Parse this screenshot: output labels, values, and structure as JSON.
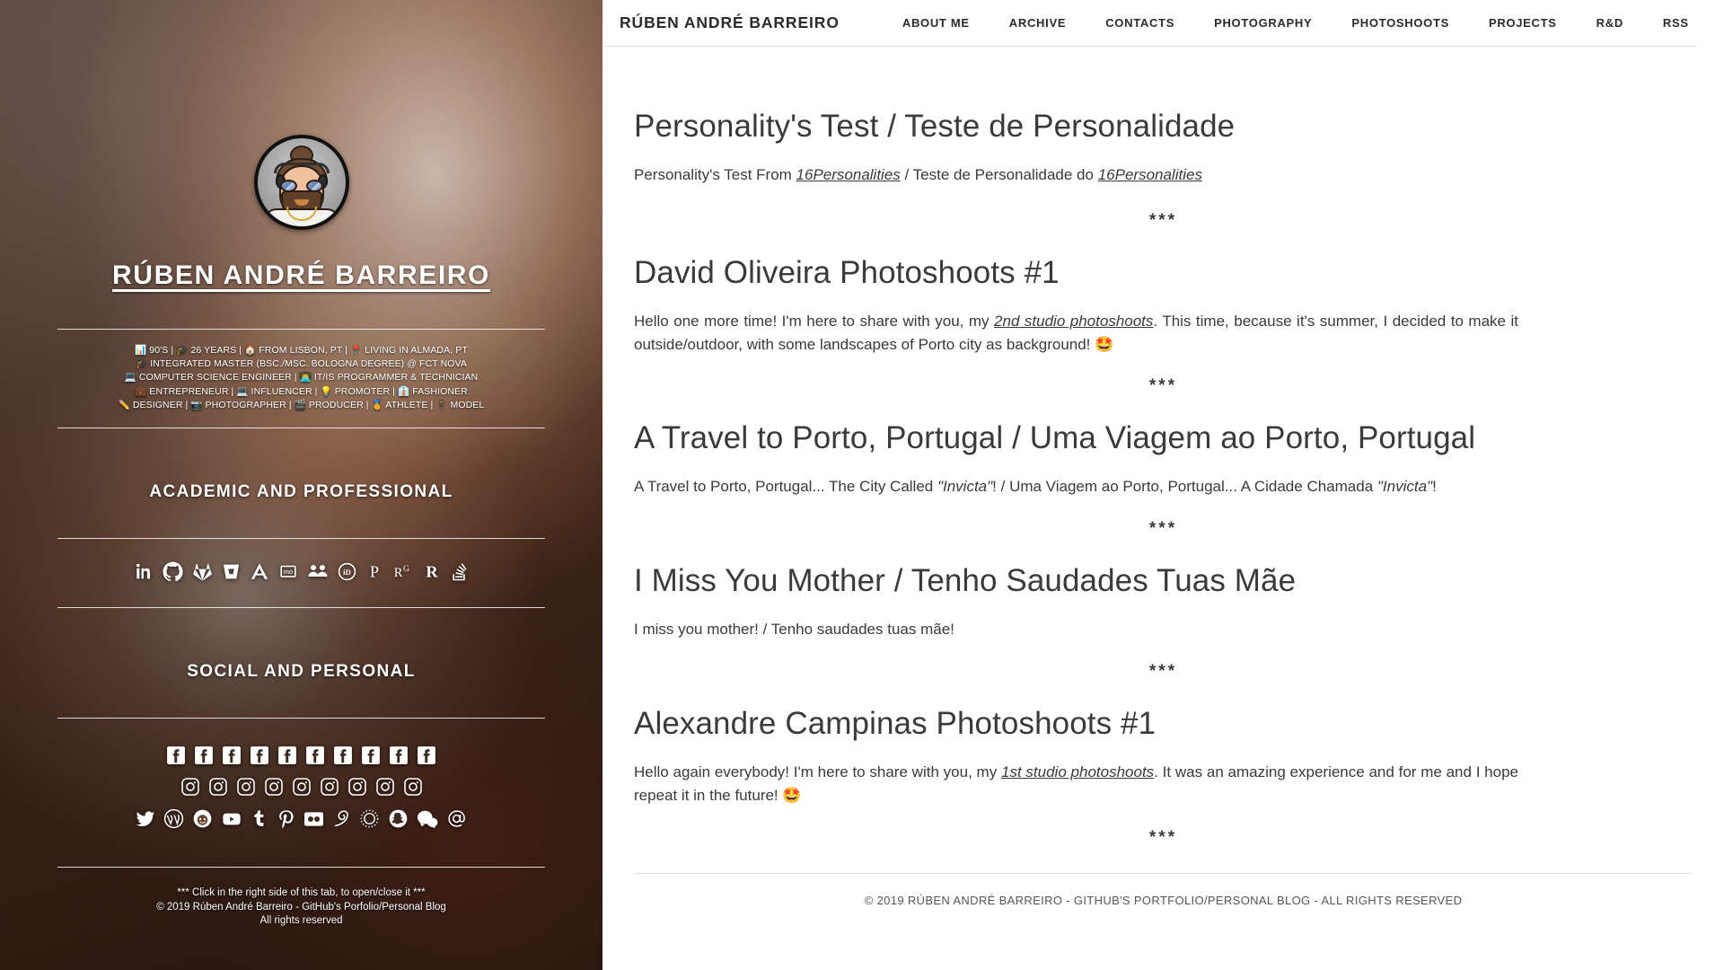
{
  "sidebar": {
    "avatar_alt": "avatar-cartoon-portrait",
    "name": "RÚBEN ANDRÉ BARREIRO",
    "bio_lines": [
      "📊 90'S | 🎓 26 YEARS | 🏠 FROM LISBON, PT | 📍 LIVING IN ALMADA, PT",
      "🎓 INTEGRATED MASTER (BSC./MSC. BOLOGNA DEGREE) @ FCT NOVA",
      "💻 COMPUTER SCIENCE ENGINEER | 👨‍💻 IT/IS PROGRAMMER & TECHNICIAN",
      "💼 ENTREPRENEUR | 💻 INFLUENCER | 💡 PROMOTER | 👔 FASHIONER",
      "✏️ DESIGNER | 📷 PHOTOGRAPHER | 🎬 PRODUCER | 🏅 ATHLETE | 🕴 MODEL"
    ],
    "section_academic": "ACADEMIC AND PROFESSIONAL",
    "section_social": "SOCIAL AND PERSONAL",
    "academic_icons": [
      "linkedin-icon",
      "github-icon",
      "gitlab-icon",
      "bitbucket-icon",
      "academia-icon",
      "mendeley-icon",
      "moodle-icon",
      "orcid-icon",
      "publons-icon",
      "researchgate-icon",
      "researcherid-icon",
      "stackoverflow-icon"
    ],
    "facebook_icons_count": 10,
    "instagram_icons_count": 9,
    "misc_icons": [
      "twitter-icon",
      "wordpress-icon",
      "reddit-icon",
      "youtube-icon",
      "tumblr-icon",
      "pinterest-icon",
      "flickr-icon",
      "500px-icon",
      "vero-icon",
      "snapchat-icon",
      "messenger-icon",
      "email-at-icon"
    ],
    "footer_lines": [
      "*** Click in the right side of this tab, to open/close it ***",
      "© 2019 Rúben André Barreiro - GitHub's Porfolio/Personal Blog",
      "All rights reserved"
    ]
  },
  "header": {
    "brand": "RÚBEN ANDRÉ BARREIRO",
    "nav": [
      {
        "label": "ABOUT ME"
      },
      {
        "label": "ARCHIVE"
      },
      {
        "label": "CONTACTS"
      },
      {
        "label": "PHOTOGRAPHY"
      },
      {
        "label": "PHOTOSHOOTS"
      },
      {
        "label": "PROJECTS"
      },
      {
        "label": "R&D"
      },
      {
        "label": "RSS"
      }
    ]
  },
  "posts": [
    {
      "title": "Personality's Test / Teste de Personalidade",
      "body_pre": "Personality's Test From ",
      "link1": "16Personalities",
      "body_mid": " / Teste de Personalidade do ",
      "link2": "16Personalities",
      "body_post": ""
    },
    {
      "title": "David Oliveira Photoshoots #1",
      "body_pre": "Hello one more time! I'm here to share with you, my ",
      "link1": "2nd studio photoshoots",
      "body_post": ". This time, because it's summer, I decided to make it outside/outdoor, with some landscapes of Porto city as background! ",
      "emoji": "🤩"
    },
    {
      "title": "A Travel to Porto, Portugal / Uma Viagem ao Porto, Portugal",
      "body_pre": "A Travel to Porto, Portugal... The City Called ",
      "italic1": "\"Invicta\"",
      "body_mid": "! / Uma Viagem ao Porto, Portugal... A Cidade Chamada ",
      "italic2": "\"Invicta\"",
      "body_post": "!"
    },
    {
      "title": "I Miss You Mother / Tenho Saudades Tuas Mãe",
      "body_pre": "I miss you mother! / Tenho saudades tuas mãe!"
    },
    {
      "title": "Alexandre Campinas Photoshoots #1",
      "body_pre": "Hello again everybody! I'm here to share with you, my ",
      "link1": "1st studio photoshoots",
      "body_post": ". It was an amazing experience and for me and I hope repeat it in the future! ",
      "emoji": "🤩"
    }
  ],
  "separator": "***",
  "footer": {
    "text": "© 2019 RÚBEN ANDRÉ BARREIRO - GITHUB'S PORTFOLIO/PERSONAL BLOG - ALL RIGHTS RESERVED"
  },
  "colors": {
    "text": "#3a3a3a",
    "nav_text": "#2b2b2b",
    "rule": "#e3e3e3",
    "sidebar_text": "#ffffff"
  }
}
